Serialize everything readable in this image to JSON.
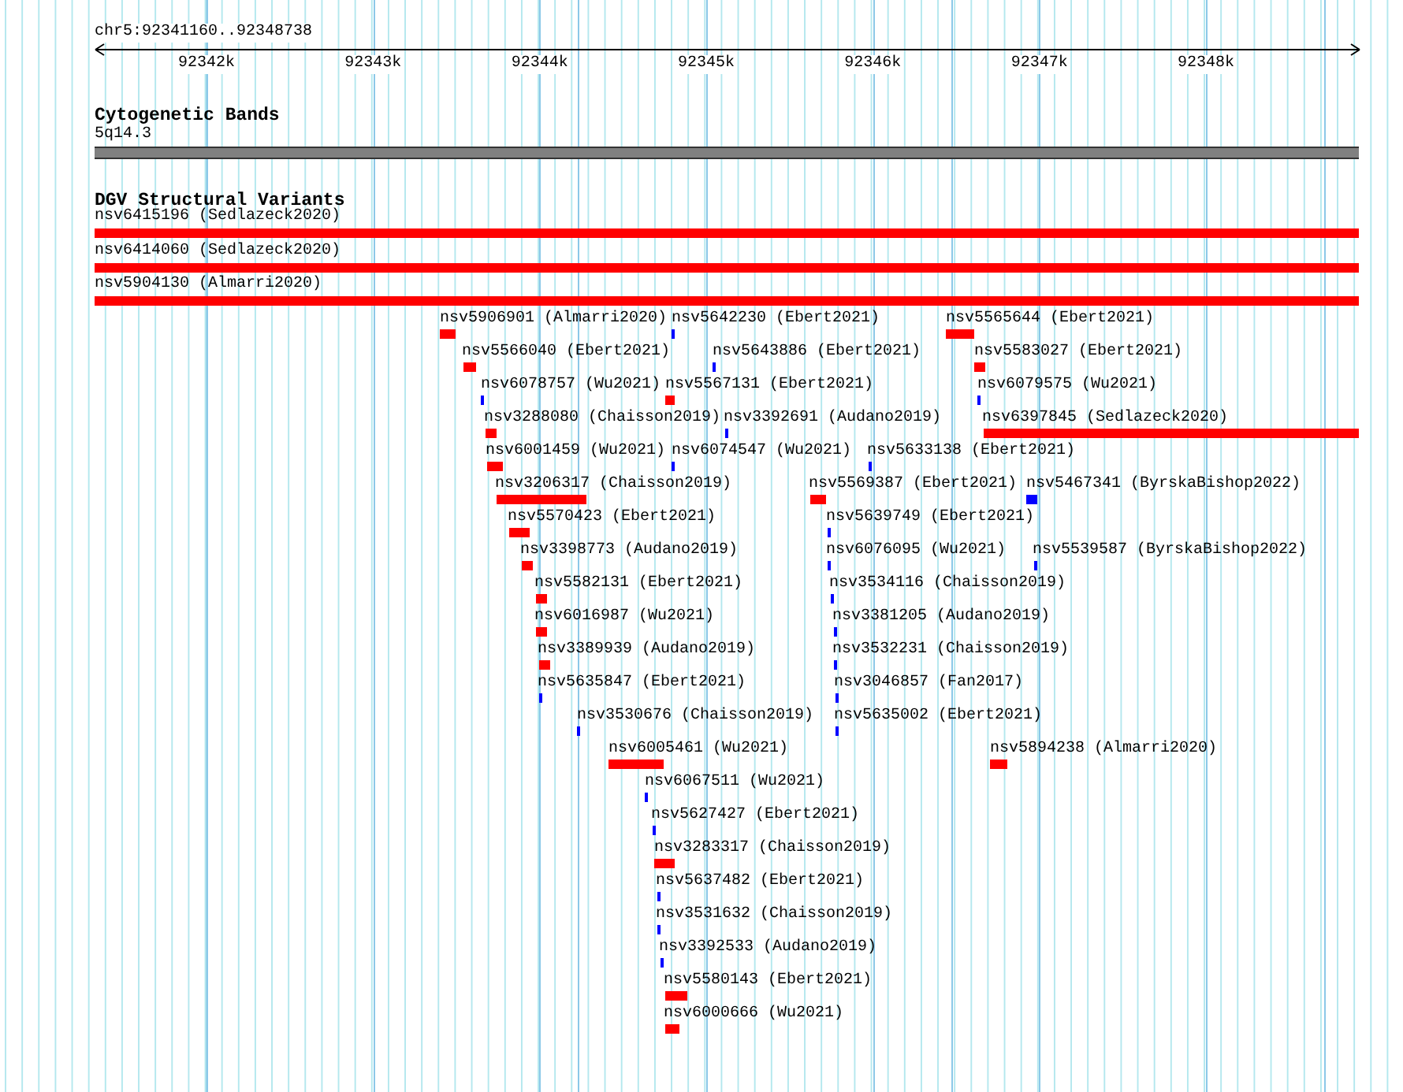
{
  "ruler": {
    "location": "chr5:92341160..92348738",
    "ticks": [
      "92342k",
      "92343k",
      "92344k",
      "92345k",
      "92346k",
      "92347k",
      "92348k"
    ]
  },
  "tracks": [
    {
      "kind": "bands",
      "title": "Cytogenetic Bands",
      "features": [
        {
          "label": "5q14.3",
          "color": "#808080"
        }
      ]
    },
    {
      "kind": "variants",
      "title": "DGV Structural Variants",
      "features": [
        {
          "label": "nsv6415196 (Sedlazeck2020)",
          "color": "#ff0000"
        },
        {
          "label": "nsv6414060 (Sedlazeck2020)",
          "color": "#ff0000"
        },
        {
          "label": "nsv5904130 (Almarri2020)",
          "color": "#ff0000"
        },
        {
          "label": "nsv5906901 (Almarri2020)",
          "color": "#ff0000"
        },
        {
          "label": "nsv5642230 (Ebert2021)",
          "color": "#0000ff"
        },
        {
          "label": "nsv5565644 (Ebert2021)",
          "color": "#ff0000"
        },
        {
          "label": "nsv5566040 (Ebert2021)",
          "color": "#ff0000"
        },
        {
          "label": "nsv5643886 (Ebert2021)",
          "color": "#0000ff"
        },
        {
          "label": "nsv5583027 (Ebert2021)",
          "color": "#ff0000"
        },
        {
          "label": "nsv6078757 (Wu2021)",
          "color": "#0000ff"
        },
        {
          "label": "nsv5567131 (Ebert2021)",
          "color": "#ff0000"
        },
        {
          "label": "nsv6079575 (Wu2021)",
          "color": "#0000ff"
        },
        {
          "label": "nsv3288080 (Chaisson2019)",
          "color": "#ff0000"
        },
        {
          "label": "nsv3392691 (Audano2019)",
          "color": "#0000ff"
        },
        {
          "label": "nsv6397845 (Sedlazeck2020)",
          "color": "#ff0000"
        },
        {
          "label": "nsv6001459 (Wu2021)",
          "color": "#ff0000"
        },
        {
          "label": "nsv6074547 (Wu2021)",
          "color": "#0000ff"
        },
        {
          "label": "nsv5633138 (Ebert2021)",
          "color": "#0000ff"
        },
        {
          "label": "nsv3206317 (Chaisson2019)",
          "color": "#ff0000"
        },
        {
          "label": "nsv5569387 (Ebert2021)",
          "color": "#ff0000"
        },
        {
          "label": "nsv5467341 (ByrskaBishop2022)",
          "color": "#0000ff"
        },
        {
          "label": "nsv5570423 (Ebert2021)",
          "color": "#ff0000"
        },
        {
          "label": "nsv5639749 (Ebert2021)",
          "color": "#0000ff"
        },
        {
          "label": "nsv3398773 (Audano2019)",
          "color": "#ff0000"
        },
        {
          "label": "nsv6076095 (Wu2021)",
          "color": "#0000ff"
        },
        {
          "label": "nsv5539587 (ByrskaBishop2022)",
          "color": "#0000ff"
        },
        {
          "label": "nsv5582131 (Ebert2021)",
          "color": "#ff0000"
        },
        {
          "label": "nsv3534116 (Chaisson2019)",
          "color": "#0000ff"
        },
        {
          "label": "nsv6016987 (Wu2021)",
          "color": "#ff0000"
        },
        {
          "label": "nsv3381205 (Audano2019)",
          "color": "#0000ff"
        },
        {
          "label": "nsv3389939 (Audano2019)",
          "color": "#ff0000"
        },
        {
          "label": "nsv3532231 (Chaisson2019)",
          "color": "#0000ff"
        },
        {
          "label": "nsv5635847 (Ebert2021)",
          "color": "#0000ff"
        },
        {
          "label": "nsv3046857 (Fan2017)",
          "color": "#0000ff"
        },
        {
          "label": "nsv3530676 (Chaisson2019)",
          "color": "#0000ff"
        },
        {
          "label": "nsv5635002 (Ebert2021)",
          "color": "#0000ff"
        },
        {
          "label": "nsv6005461 (Wu2021)",
          "color": "#ff0000"
        },
        {
          "label": "nsv5894238 (Almarri2020)",
          "color": "#ff0000"
        },
        {
          "label": "nsv6067511 (Wu2021)",
          "color": "#0000ff"
        },
        {
          "label": "nsv5627427 (Ebert2021)",
          "color": "#0000ff"
        },
        {
          "label": "nsv3283317 (Chaisson2019)",
          "color": "#ff0000"
        },
        {
          "label": "nsv5637482 (Ebert2021)",
          "color": "#0000ff"
        },
        {
          "label": "nsv3531632 (Chaisson2019)",
          "color": "#0000ff"
        },
        {
          "label": "nsv3392533 (Audano2019)",
          "color": "#0000ff"
        },
        {
          "label": "nsv5580143 (Ebert2021)",
          "color": "#ff0000"
        },
        {
          "label": "nsv6000666 (Wu2021)",
          "color": "#ff0000"
        }
      ]
    }
  ]
}
